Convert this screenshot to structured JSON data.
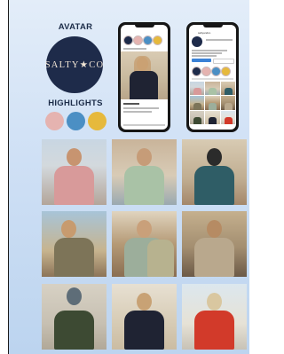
{
  "avatar_section": {
    "label": "AVATAR",
    "brand_text": "SALTY★CO",
    "brand_color": "#1e2b4a"
  },
  "highlights_section": {
    "label": "HIGHLIGHTS",
    "colors": [
      "#e5b3b0",
      "#4b8fc4",
      "#e6b93c"
    ]
  },
  "profile_phone": {
    "username": "saltyandco"
  },
  "feed_photos": [
    {
      "subject": "woman in pink sweatshirt",
      "shirt": "#d89a9a"
    },
    {
      "subject": "woman in green sweatshirt",
      "shirt": "#a9c2a6"
    },
    {
      "subject": "man in teal tee",
      "shirt": "#2f5d66"
    },
    {
      "subject": "woman in olive tee",
      "shirt": "#7d7458"
    },
    {
      "subject": "two women on pier",
      "shirt": "#9cae9b"
    },
    {
      "subject": "woman in tan tee",
      "shirt": "#b9a88d"
    },
    {
      "subject": "man in olive long sleeve",
      "shirt": "#3d4a33"
    },
    {
      "subject": "woman in navy sweatshirt",
      "shirt": "#1f2333"
    },
    {
      "subject": "woman in red sweatshirt",
      "shirt": "#d23a2a"
    }
  ]
}
